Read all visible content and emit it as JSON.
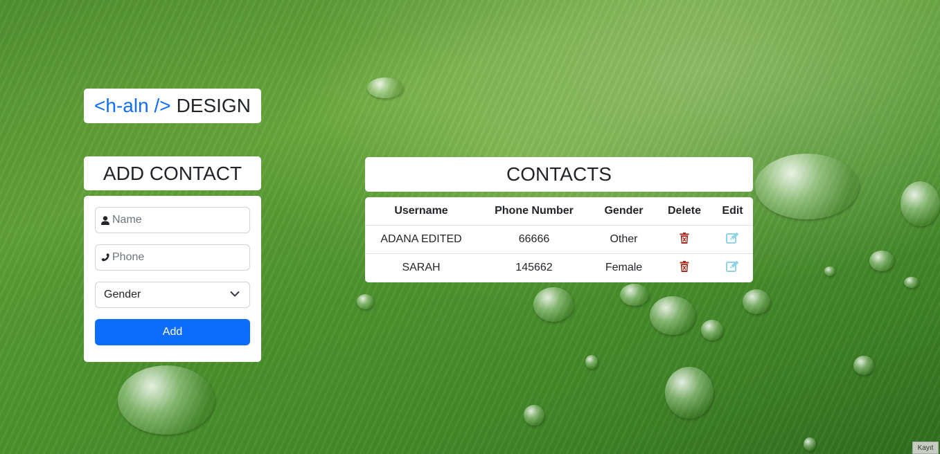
{
  "brand": {
    "code": "<h-aln />",
    "word": "DESIGN"
  },
  "add_form": {
    "title": "ADD CONTACT",
    "name_placeholder": "Name",
    "name_icon": "user-icon",
    "phone_placeholder": "Phone",
    "phone_icon": "phone-icon",
    "gender_selected": "Gender",
    "add_label": "Add"
  },
  "contacts": {
    "title": "CONTACTS",
    "columns": [
      "Username",
      "Phone Number",
      "Gender",
      "Delete",
      "Edit"
    ],
    "rows": [
      {
        "username": "ADANA EDITED",
        "phone": "66666",
        "gender": "Other"
      },
      {
        "username": "SARAH",
        "phone": "145662",
        "gender": "Female"
      }
    ]
  },
  "corner_button": "Kayıt",
  "colors": {
    "primary": "#0d6efd",
    "delete_icon": "#a52a1a",
    "edit_icon": "#8fd3e8",
    "panel_bg": "#ffffff"
  }
}
